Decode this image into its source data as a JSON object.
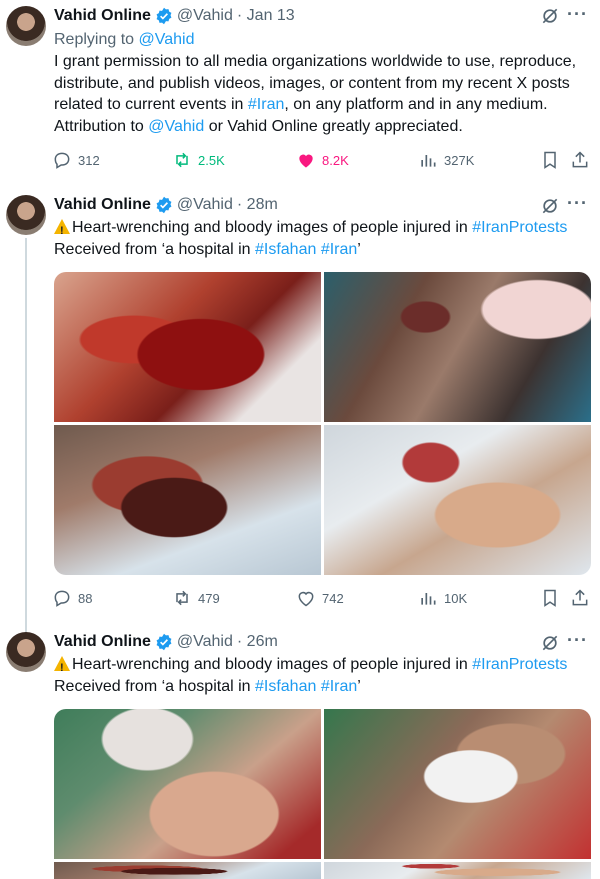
{
  "colors": {
    "accent": "#1d9bf0",
    "retweet_active": "#00ba7c",
    "like_active": "#f91880",
    "muted": "#536471"
  },
  "tweets": [
    {
      "author": {
        "name": "Vahid Online",
        "handle": "@Vahid",
        "time": "· Jan 13"
      },
      "replying_label": "Replying to",
      "replying_handle": "@Vahid",
      "text_parts": {
        "p1": "I grant permission to all media organizations worldwide to use, reproduce, distribute, and publish videos, images, or content from my recent X posts related to current events in ",
        "tag1": "#Iran",
        "p2": ", on any platform and in any medium. Attribution to ",
        "mention": "@Vahid",
        "p3": " or Vahid Online greatly appreciated."
      },
      "stats": {
        "replies": "312",
        "retweets": "2.5K",
        "likes": "8.2K",
        "views": "327K"
      }
    },
    {
      "author": {
        "name": "Vahid Online",
        "handle": "@Vahid",
        "time": "· 28m"
      },
      "text_parts": {
        "p1": "Heart-wrenching and bloody images of people injured in ",
        "tag1": "#IranProtests",
        "p2": "Received from ‘a hospital in ",
        "tag2": "#Isfahan",
        "tag3": "#Iran",
        "p3": "’"
      },
      "stats": {
        "replies": "88",
        "retweets": "479",
        "likes": "742",
        "views": "10K"
      }
    },
    {
      "author": {
        "name": "Vahid Online",
        "handle": "@Vahid",
        "time": "· 26m"
      },
      "text_parts": {
        "p1": "Heart-wrenching and bloody images of people injured in ",
        "tag1": "#IranProtests",
        "p2": "Received from ‘a hospital in ",
        "tag2": "#Isfahan",
        "tag3": "#Iran",
        "p3": "’"
      }
    }
  ],
  "icons": [
    "verified-badge-icon",
    "grok-icon",
    "more-icon",
    "reply-icon",
    "retweet-icon",
    "like-icon",
    "views-icon",
    "bookmark-icon",
    "share-icon",
    "warning-icon"
  ]
}
